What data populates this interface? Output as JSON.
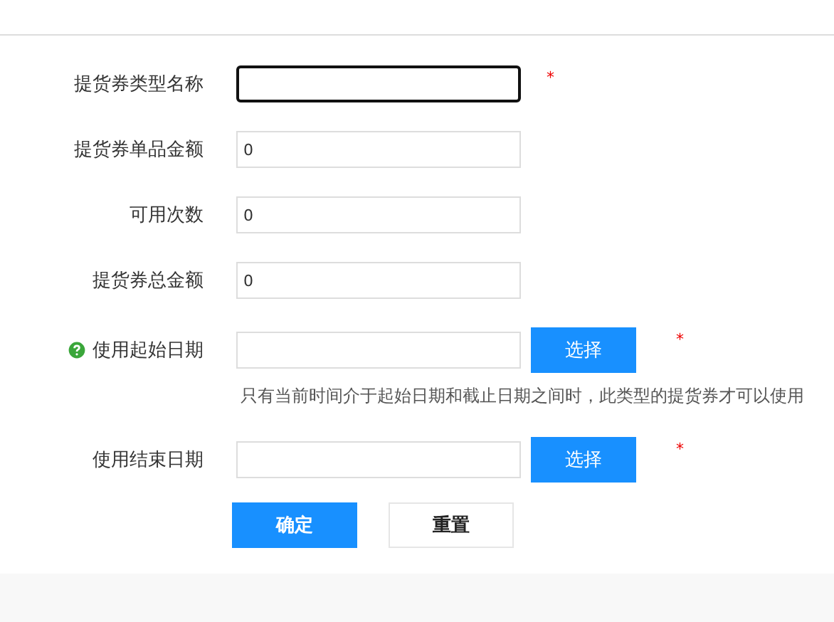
{
  "fields": [
    {
      "kind": "text",
      "label": "提货券类型名称",
      "focused": true,
      "required": true,
      "help": false
    },
    {
      "kind": "text",
      "label": "提货券单品金额",
      "value": "0",
      "focused": false,
      "required": false,
      "help": false
    },
    {
      "kind": "text",
      "label": "可用次数",
      "value": "0",
      "focused": false,
      "required": false,
      "help": false
    },
    {
      "kind": "text",
      "label": "提货券总金额",
      "value": "0",
      "focused": false,
      "required": false,
      "help": false
    },
    {
      "kind": "date",
      "label": "使用起始日期",
      "button": "选择",
      "required": true,
      "help": true,
      "hint": "只有当前时间介于起始日期和截止日期之间时，此类型的提货券才可以使用"
    },
    {
      "kind": "date",
      "label": "使用结束日期",
      "button": "选择",
      "required": true,
      "help": false
    }
  ],
  "actions": [
    {
      "kind": "primary",
      "label": "确定"
    },
    {
      "kind": "secondary",
      "label": "重置"
    }
  ],
  "required_mark": "*"
}
